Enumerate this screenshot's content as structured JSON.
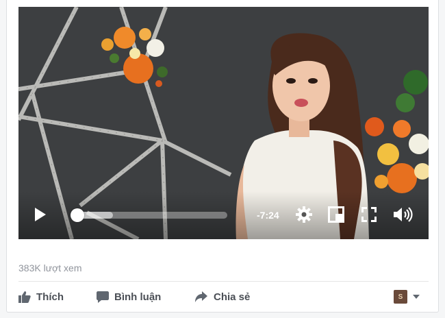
{
  "video": {
    "time_remaining": "-7:24",
    "progress": 0.01,
    "buffered": 0.26,
    "icons": [
      "play-icon",
      "gear-icon",
      "picture-in-picture-icon",
      "fullscreen-icon",
      "volume-icon"
    ]
  },
  "stats": {
    "views": "383K lượt xem"
  },
  "actions": {
    "like_label": "Thích",
    "comment_label": "Bình luận",
    "share_label": "Chia sẻ"
  },
  "colors": {
    "accent": "#4080ff",
    "text_secondary": "#90949c",
    "action_text": "#4b4f56"
  }
}
